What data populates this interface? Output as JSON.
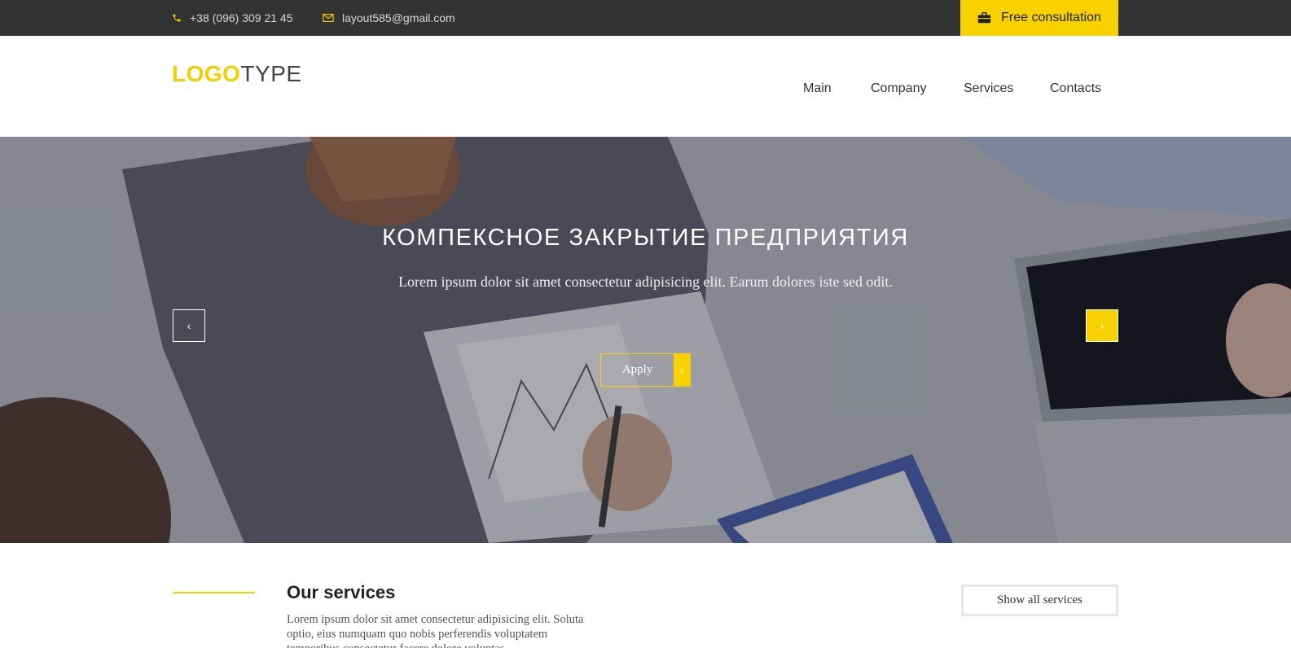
{
  "topbar": {
    "phone": "+38 (096) 309 21 45",
    "email": "layout585@gmail.com",
    "consult_label": "Free consultation",
    "icons": [
      "phone-icon",
      "envelope-icon",
      "briefcase-icon"
    ],
    "accent": "#f8d200",
    "background": "#333333"
  },
  "header": {
    "logo_part1": "LOGO",
    "logo_part2": "TYPE",
    "nav": [
      "Main",
      "Company",
      "Services",
      "Contacts"
    ]
  },
  "hero": {
    "title": "КОМПЕКСНОЕ ЗАКРЫТИЕ ПРЕДПРИЯТИЯ",
    "text": "Lorem ipsum dolor sit amet consectetur adipisicing elit. Earum dolores iste sed odit.",
    "apply_label": "Apply",
    "prev_arrow": "‹",
    "next_arrow": "›",
    "apply_arrow": "›"
  },
  "services": {
    "title": "Our services",
    "text": "Lorem ipsum dolor sit amet consectetur adipisicing elit. Soluta optio, eius numquam quo nobis perferendis voluptatem temporibus consectetur facere dolore voluptas.",
    "show_all_label": "Show all services"
  }
}
